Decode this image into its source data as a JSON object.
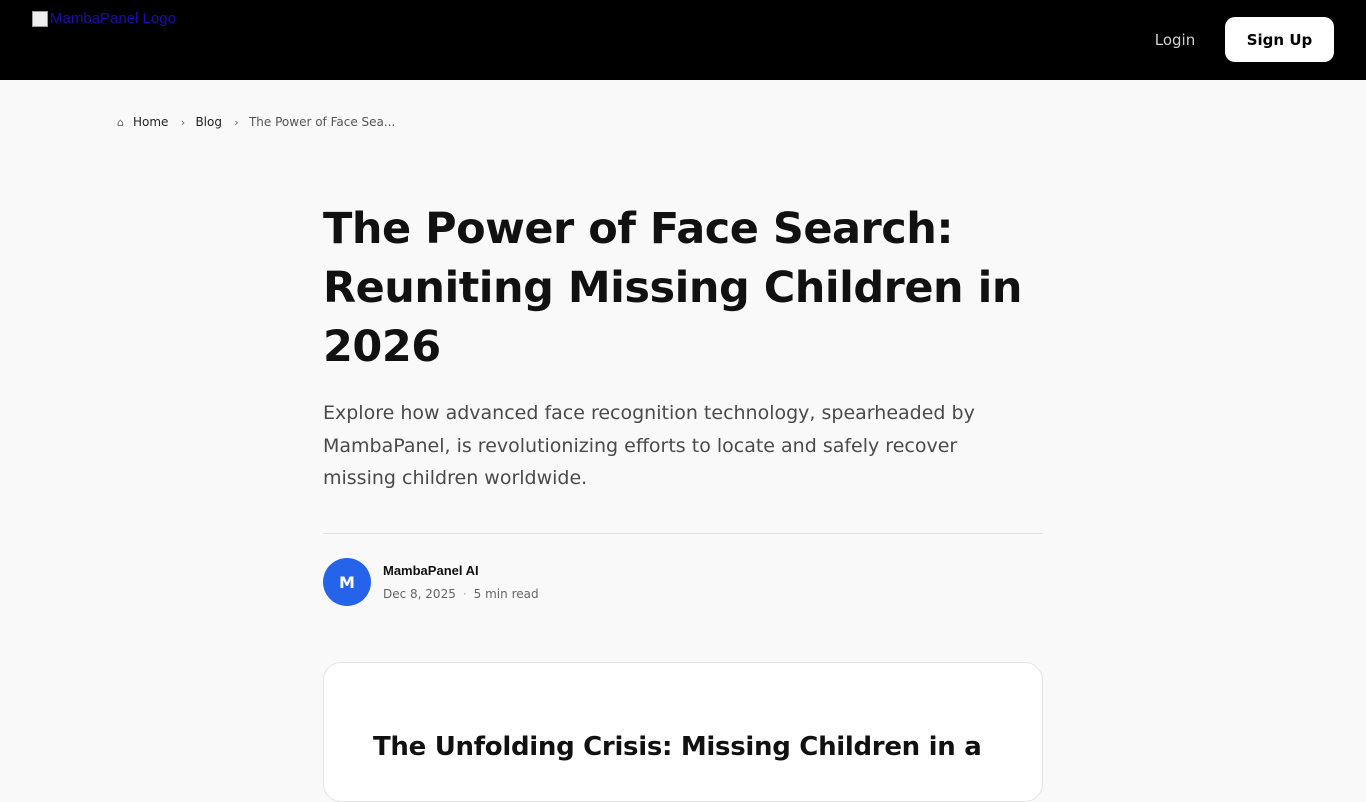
{
  "header": {
    "logo_alt": "MambaPanel Logo",
    "login_label": "Login",
    "signup_label": "Sign Up"
  },
  "breadcrumb": {
    "items": [
      {
        "label": "Home",
        "icon": "home-icon"
      },
      {
        "label": "Blog",
        "icon": "chevron-right-icon"
      },
      {
        "label": "The Power of Face Sea...",
        "icon": "chevron-right-icon"
      }
    ]
  },
  "article": {
    "title": "The Power of Face Search: Reuniting Missing Children in 2026",
    "lede": "Explore how advanced face recognition technology, spearheaded by MambaPanel, is revolutionizing efforts to locate and safely recover missing children worldwide.",
    "author": {
      "initial": "M",
      "name": "MambaPanel AI",
      "date": "Dec 8, 2025",
      "separator": "·",
      "read_time": "5 min read"
    },
    "section_heading": "The Unfolding Crisis: Missing Children in a"
  },
  "colors": {
    "header_bg": "#000000",
    "page_bg": "#f9f9f9",
    "avatar_bg": "#2563eb",
    "text_primary": "#111111",
    "text_secondary": "#4a4a4a"
  }
}
